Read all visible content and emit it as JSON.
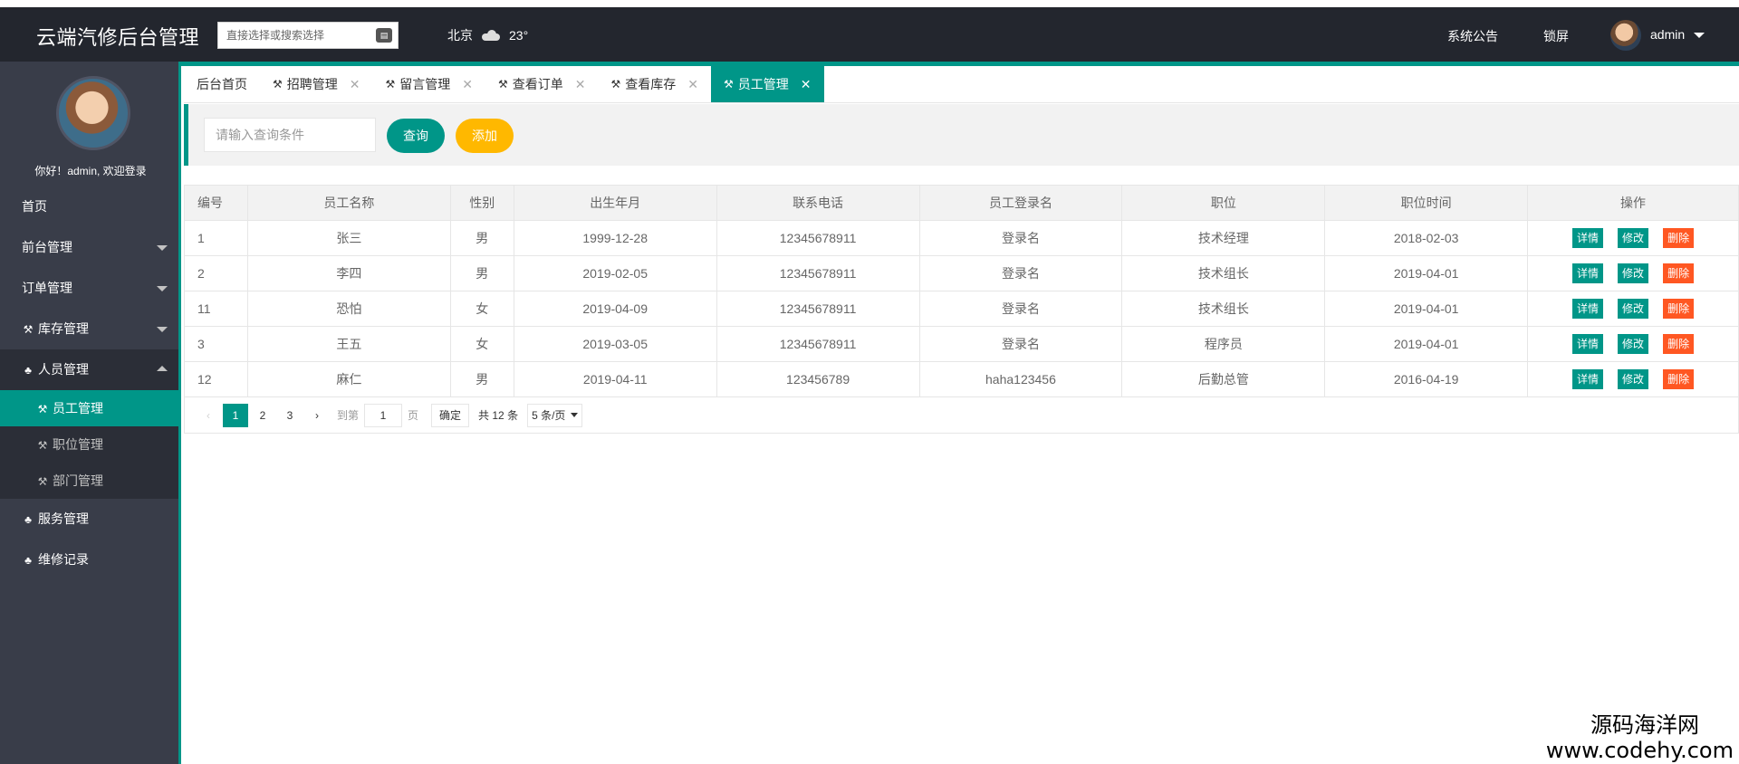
{
  "header": {
    "title": "云端汽修后台管理",
    "search_placeholder": "直接选择或搜索选择",
    "city": "北京",
    "temperature": "23°",
    "weather_icon": "cloud-icon",
    "notice": "系统公告",
    "lock": "锁屏",
    "user": "admin"
  },
  "sidebar": {
    "welcome": "你好！admin, 欢迎登录",
    "items": [
      {
        "label": "首页"
      },
      {
        "label": "前台管理"
      },
      {
        "label": "订单管理"
      },
      {
        "label": "库存管理"
      },
      {
        "label": "人员管理"
      },
      {
        "label": "服务管理"
      },
      {
        "label": "维修记录"
      }
    ],
    "subitems": [
      {
        "label": "员工管理"
      },
      {
        "label": "职位管理"
      },
      {
        "label": "部门管理"
      }
    ]
  },
  "tabs": [
    {
      "label": "后台首页"
    },
    {
      "label": "招聘管理"
    },
    {
      "label": "留言管理"
    },
    {
      "label": "查看订单"
    },
    {
      "label": "查看库存"
    },
    {
      "label": "员工管理"
    }
  ],
  "toolbar": {
    "query_placeholder": "请输入查询条件",
    "query_label": "查询",
    "add_label": "添加"
  },
  "table": {
    "headers": [
      "编号",
      "员工名称",
      "性别",
      "出生年月",
      "联系电话",
      "员工登录名",
      "职位",
      "职位时间",
      "操作"
    ],
    "rows": [
      [
        "1",
        "张三",
        "男",
        "1999-12-28",
        "12345678911",
        "登录名",
        "技术经理",
        "2018-02-03"
      ],
      [
        "2",
        "李四",
        "男",
        "2019-02-05",
        "12345678911",
        "登录名",
        "技术组长",
        "2019-04-01"
      ],
      [
        "11",
        "恐怕",
        "女",
        "2019-04-09",
        "12345678911",
        "登录名",
        "技术组长",
        "2019-04-01"
      ],
      [
        "3",
        "王五",
        "女",
        "2019-03-05",
        "12345678911",
        "登录名",
        "程序员",
        "2019-04-01"
      ],
      [
        "12",
        "麻仁",
        "男",
        "2019-04-11",
        "123456789",
        "haha123456",
        "后勤总管",
        "2016-04-19"
      ]
    ],
    "actions": {
      "detail": "详情",
      "edit": "修改",
      "delete": "删除"
    }
  },
  "pager": {
    "pages": [
      "1",
      "2",
      "3"
    ],
    "goto_label": "到第",
    "page_value": "1",
    "page_unit": "页",
    "confirm": "确定",
    "total": "共 12 条",
    "page_size": "5 条/页"
  },
  "watermark": {
    "line1": "源码海洋网",
    "line2": "www.codehy.com"
  },
  "colors": {
    "primary": "#009688",
    "warning": "#ffb800",
    "danger": "#ff5722",
    "header_bg": "#23262e",
    "sidebar_bg": "#393d49"
  }
}
